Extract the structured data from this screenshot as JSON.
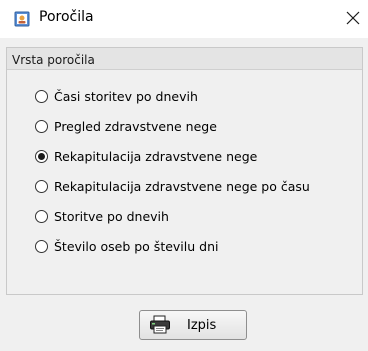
{
  "window": {
    "title": "Poročila",
    "close_glyph": "✕"
  },
  "group": {
    "label": "Vrsta poročila",
    "options": [
      {
        "label": "Časi storitev po dnevih",
        "checked": false
      },
      {
        "label": "Pregled zdravstvene nege",
        "checked": false
      },
      {
        "label": "Rekapitulacija zdravstvene nege",
        "checked": true
      },
      {
        "label": "Rekapitulacija zdravstvene nege po času",
        "checked": false
      },
      {
        "label": "Storitve po dnevih",
        "checked": false
      },
      {
        "label": "Število oseb po številu dni",
        "checked": false
      }
    ]
  },
  "actions": {
    "print_label": "Izpis"
  },
  "icons": {
    "app": "report-icon",
    "print": "printer-icon",
    "close": "close-icon"
  },
  "colors": {
    "window_bg": "#f0f0f0",
    "titlebar_bg": "#ffffff",
    "group_header_bg": "#e4e4e4"
  }
}
